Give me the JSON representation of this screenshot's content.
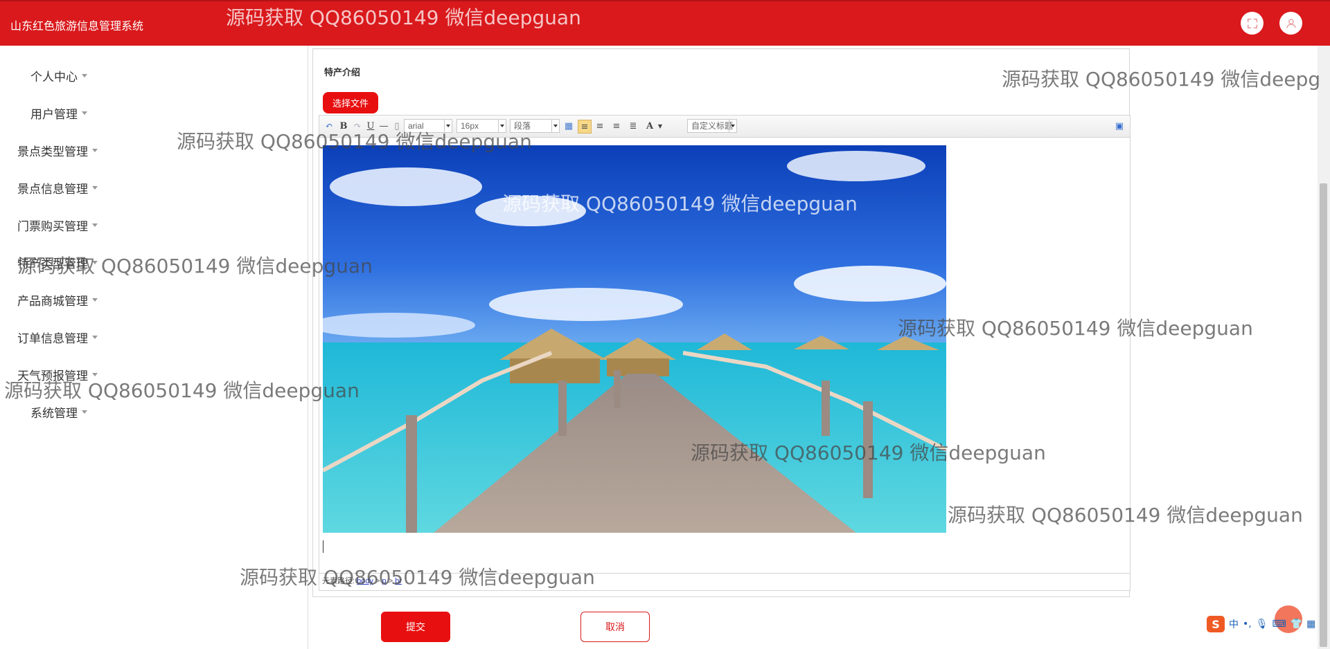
{
  "header": {
    "app_title": "山东红色旅游信息管理系统",
    "icons": [
      "fullscreen-icon",
      "user-icon"
    ]
  },
  "sidebar": {
    "items": [
      {
        "label": "个人中心"
      },
      {
        "label": "用户管理"
      },
      {
        "label": "景点类型管理"
      },
      {
        "label": "景点信息管理"
      },
      {
        "label": "门票购买管理"
      },
      {
        "label": "特产类型管理"
      },
      {
        "label": "产品商城管理"
      },
      {
        "label": "订单信息管理"
      },
      {
        "label": "天气预报管理"
      },
      {
        "label": "系统管理"
      }
    ]
  },
  "form": {
    "field_label": "特产介绍",
    "choose_file_label": "选择文件",
    "submit_label": "提交",
    "cancel_label": "取消"
  },
  "editor": {
    "font_family_value": "arial",
    "font_size_value": "16px",
    "paragraph_value": "段落",
    "custom_title_value": "自定义标题",
    "element_path_label": "元素路径:",
    "element_path": [
      "body",
      "p",
      "br"
    ],
    "image_alt": "Tropical overwater bungalows with wooden pier"
  },
  "watermark": {
    "text": "源码获取 QQ86050149 微信deepguan",
    "clipped_text": "源码获取 QQ86050149 微信deepg"
  },
  "ime": {
    "logo": "S",
    "mode": "中",
    "punct": "•,"
  },
  "colors": {
    "brand_red": "#d9191c",
    "button_red": "#e80f10"
  }
}
